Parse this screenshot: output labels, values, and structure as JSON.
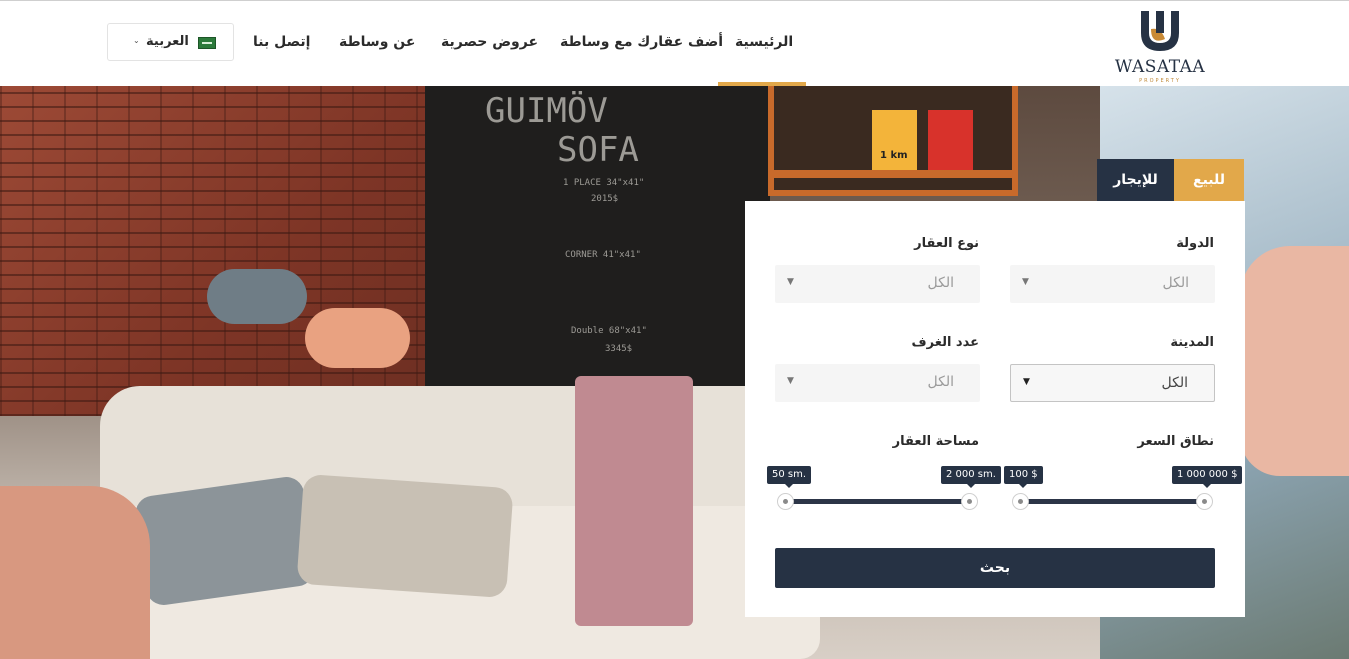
{
  "brand": {
    "name": "WASATAA",
    "tagline": "PROPERTY",
    "logo_icon": "wasataa-logo-icon"
  },
  "nav": {
    "items": [
      {
        "label": "الرئيسية",
        "active": true
      },
      {
        "label": "أضف عقارك مع وساطة",
        "active": false
      },
      {
        "label": "عروض حصرية",
        "active": false
      },
      {
        "label": "عن وساطة",
        "active": false
      },
      {
        "label": "إتصل بنا",
        "active": false
      }
    ],
    "language": {
      "label": "العربية",
      "flag_icon": "saudi-flag-icon",
      "caret_icon": "chevron-down-icon"
    }
  },
  "hero": {
    "chalkboard": {
      "line1": "GUIMÖV",
      "line2": "SOFA",
      "line3": "1 PLACE 34\"x41\"",
      "line4": "2015$",
      "line5": "CORNER 41\"x41\"",
      "line6": "Double 68\"x41\"",
      "line7": "3345$"
    },
    "book_label_1": "1 km"
  },
  "search": {
    "tabs": [
      {
        "label": "للبيع",
        "active": true
      },
      {
        "label": "للإيجار",
        "active": false
      }
    ],
    "country": {
      "label": "الدولة",
      "value": "الكل"
    },
    "property_type": {
      "label": "نوع العقار",
      "value": "الكل"
    },
    "city": {
      "label": "المدينة",
      "value": "الكل"
    },
    "rooms": {
      "label": "عدد الغرف",
      "value": "الكل"
    },
    "price_range": {
      "label": "نطاق السعر",
      "min": "100 $",
      "max": "1 000 000 $"
    },
    "area": {
      "label": "مساحة العقار",
      "min": "50 sm.",
      "max": "2 000 sm."
    },
    "button_label": "بحث"
  },
  "colors": {
    "accent": "#e2a84a",
    "navy": "#263244"
  }
}
